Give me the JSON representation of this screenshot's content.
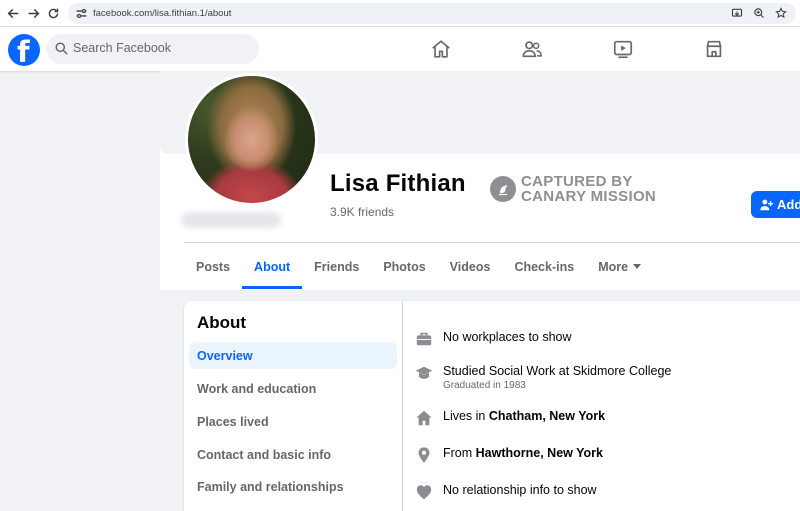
{
  "browser": {
    "url": "facebook.com/lisa.fithian.1/about"
  },
  "nav": {
    "logo_letter": "f",
    "search_placeholder": "Search Facebook",
    "icons": [
      "home-icon",
      "friends-icon",
      "video-icon",
      "marketplace-icon"
    ]
  },
  "profile": {
    "name": "Lisa Fithian",
    "friends": "3.9K friends",
    "add_label": "Add",
    "watermark_line1": "CAPTURED BY",
    "watermark_line2": "CANARY MISSION"
  },
  "tabs": [
    {
      "label": "Posts",
      "active": false
    },
    {
      "label": "About",
      "active": true
    },
    {
      "label": "Friends",
      "active": false
    },
    {
      "label": "Photos",
      "active": false
    },
    {
      "label": "Videos",
      "active": false
    },
    {
      "label": "Check-ins",
      "active": false
    },
    {
      "label": "More",
      "active": false
    }
  ],
  "about": {
    "title": "About",
    "sidebar": [
      {
        "label": "Overview",
        "active": true
      },
      {
        "label": "Work and education",
        "active": false
      },
      {
        "label": "Places lived",
        "active": false
      },
      {
        "label": "Contact and basic info",
        "active": false
      },
      {
        "label": "Family and relationships",
        "active": false
      }
    ],
    "overview": {
      "work": "No workplaces to show",
      "education_prefix": "Studied Social Work at Skidmore College",
      "education_sub": "Graduated in 1983",
      "lives_prefix": "Lives in ",
      "lives_place": "Chatham, New York",
      "from_prefix": "From ",
      "from_place": "Hawthorne, New York",
      "relationship": "No relationship info to show"
    }
  },
  "colors": {
    "brand_blue": "#0866ff",
    "secondary_text": "#65676b",
    "background": "#f0f2f5",
    "active_tab_bg": "#ebf5ff",
    "watermark_gray": "#8d8f92"
  }
}
